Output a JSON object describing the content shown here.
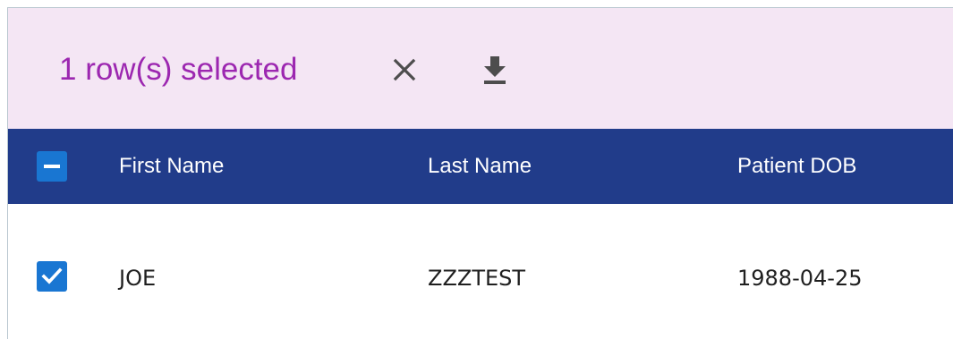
{
  "selection_bar": {
    "count_label": "1 row(s) selected",
    "clear_icon": "close-icon",
    "download_icon": "download-icon",
    "accent_color": "#9c27b0",
    "background_color": "#f4e6f4"
  },
  "table": {
    "header_background": "#213c8a",
    "header_select_all_state": "indeterminate",
    "columns": [
      "First Name",
      "Last Name",
      "Patient DOB"
    ],
    "rows": [
      {
        "selected": true,
        "cells": [
          "JOE",
          "ZZZTEST",
          "1988-04-25"
        ]
      }
    ]
  }
}
